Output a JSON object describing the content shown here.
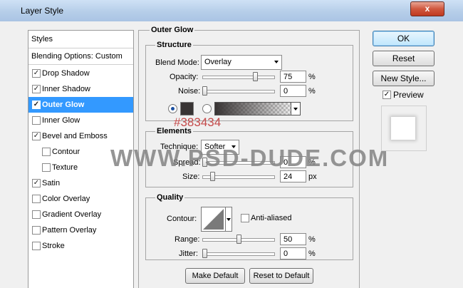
{
  "window": {
    "title": "Layer Style",
    "close_label": "x"
  },
  "styles_list": {
    "header": "Styles",
    "blending_options": "Blending Options: Custom",
    "items": [
      {
        "label": "Drop Shadow",
        "checked": true,
        "selected": false,
        "indent": false
      },
      {
        "label": "Inner Shadow",
        "checked": true,
        "selected": false,
        "indent": false
      },
      {
        "label": "Outer Glow",
        "checked": true,
        "selected": true,
        "indent": false
      },
      {
        "label": "Inner Glow",
        "checked": false,
        "selected": false,
        "indent": false
      },
      {
        "label": "Bevel and Emboss",
        "checked": true,
        "selected": false,
        "indent": false
      },
      {
        "label": "Contour",
        "checked": false,
        "selected": false,
        "indent": true
      },
      {
        "label": "Texture",
        "checked": false,
        "selected": false,
        "indent": true
      },
      {
        "label": "Satin",
        "checked": true,
        "selected": false,
        "indent": false
      },
      {
        "label": "Color Overlay",
        "checked": false,
        "selected": false,
        "indent": false
      },
      {
        "label": "Gradient Overlay",
        "checked": false,
        "selected": false,
        "indent": false
      },
      {
        "label": "Pattern Overlay",
        "checked": false,
        "selected": false,
        "indent": false
      },
      {
        "label": "Stroke",
        "checked": false,
        "selected": false,
        "indent": false
      }
    ]
  },
  "outer_glow": {
    "title": "Outer Glow",
    "structure": {
      "title": "Structure",
      "blend_mode_label": "Blend Mode:",
      "blend_mode_value": "Overlay",
      "opacity_label": "Opacity:",
      "opacity_value": "75",
      "opacity_fraction": 0.75,
      "noise_label": "Noise:",
      "noise_value": "0",
      "noise_fraction": 0,
      "unit": "%",
      "glow_color": "#383434",
      "color_solid_selected": true
    },
    "color_annotation": "#383434",
    "elements": {
      "title": "Elements",
      "technique_label": "Technique:",
      "technique_value": "Softer",
      "spread_label": "Spread:",
      "spread_value": "0",
      "spread_unit": "%",
      "size_label": "Size:",
      "size_value": "24",
      "size_unit": "px"
    },
    "quality": {
      "title": "Quality",
      "contour_label": "Contour:",
      "anti_aliased_label": "Anti-aliased",
      "anti_aliased_checked": false,
      "range_label": "Range:",
      "range_value": "50",
      "range_fraction": 0.5,
      "jitter_label": "Jitter:",
      "jitter_value": "0",
      "jitter_fraction": 0,
      "unit": "%"
    },
    "buttons": {
      "make_default": "Make Default",
      "reset_to_default": "Reset to Default"
    }
  },
  "actions": {
    "ok": "OK",
    "reset": "Reset",
    "new_style": "New Style...",
    "preview_label": "Preview",
    "preview_checked": true
  },
  "watermark": "WWW.PSD-DUDE.COM"
}
